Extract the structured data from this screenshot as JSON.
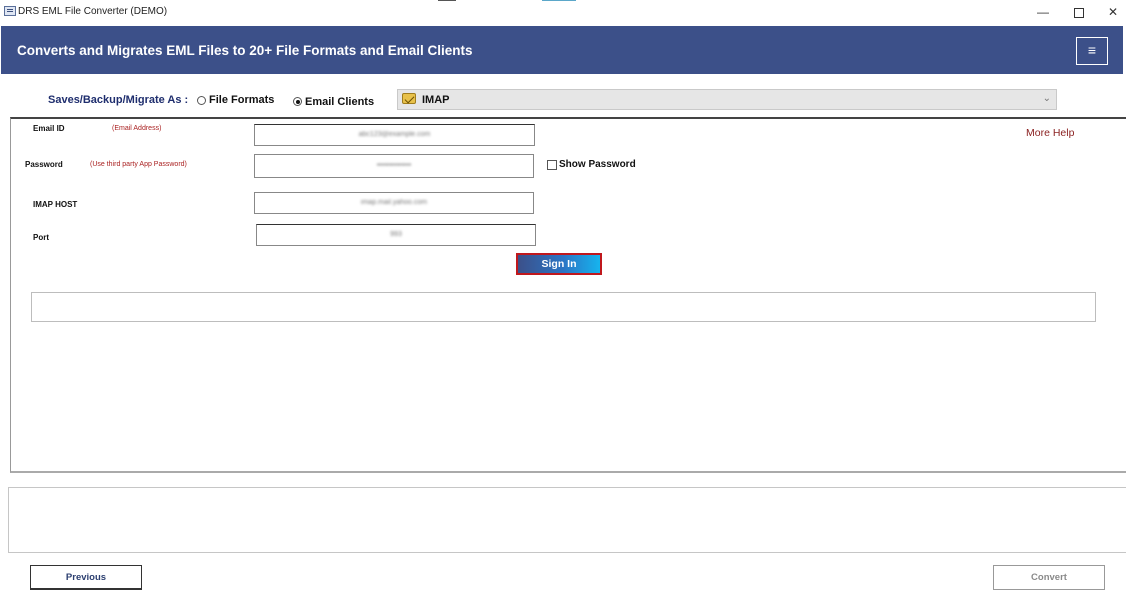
{
  "window": {
    "title": "DRS EML File Converter (DEMO)",
    "minimize_glyph": "—",
    "close_glyph": "✕"
  },
  "banner": {
    "title": "Converts and Migrates EML Files to 20+ File Formats and Email Clients",
    "menu_glyph": "≡"
  },
  "save_as": {
    "label": "Saves/Backup/Migrate As :",
    "options": [
      {
        "label": "File Formats",
        "selected": false
      },
      {
        "label": "Email Clients",
        "selected": true
      }
    ],
    "selected_client": "IMAP",
    "chevron_glyph": "⌄"
  },
  "form": {
    "email": {
      "label": "Email ID",
      "hint": "(Email Address)",
      "value": "abc123@example.com"
    },
    "password": {
      "label": "Password",
      "hint": "(Use third party App Password)",
      "value": "••••••••••••••"
    },
    "imap_host": {
      "label": "IMAP HOST",
      "value": "imap.mail.yahoo.com"
    },
    "port": {
      "label": "Port",
      "value": "993"
    },
    "show_password_label": "Show Password",
    "show_password_checked": false,
    "more_help": "More Help",
    "sign_in": "Sign In"
  },
  "footer": {
    "previous": "Previous",
    "convert": "Convert"
  },
  "colors": {
    "banner": "#3c5089",
    "hint_red": "#a22222",
    "sign_in_border": "#c0181d"
  }
}
